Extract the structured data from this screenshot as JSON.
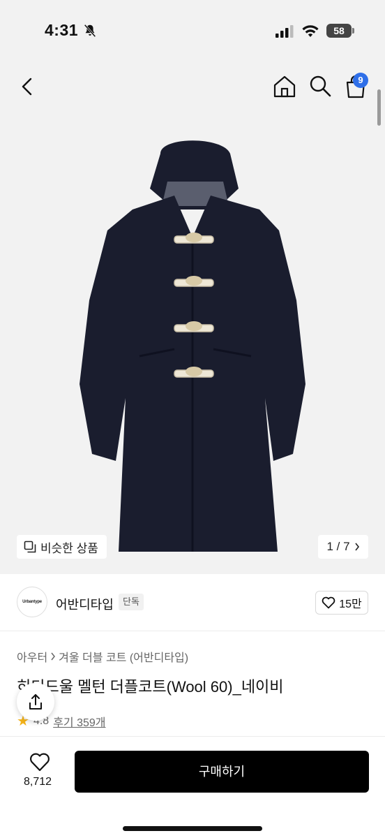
{
  "status_bar": {
    "time": "4:31",
    "battery": "58"
  },
  "header": {
    "cart_count": "9"
  },
  "gallery": {
    "similar_label": "비슷한 상품",
    "page_indicator": "1 / 7"
  },
  "seller": {
    "avatar_text": "Urbantype",
    "name": "어반디타입",
    "badge": "단독",
    "likes": "15만"
  },
  "product": {
    "breadcrumb": [
      "아우터",
      "겨울 더블 코트 (어반디타입)"
    ],
    "title": "히디드울 멜턴 더플코트(Wool 60)_네이비",
    "rating": "4.8",
    "reviews": "후기 359개"
  },
  "bottom_bar": {
    "wish_count": "8,712",
    "buy_label": "구매하기"
  },
  "colors": {
    "accent": "#2f6fe8",
    "coat": "#1a1d2e",
    "star": "#f3b219"
  }
}
